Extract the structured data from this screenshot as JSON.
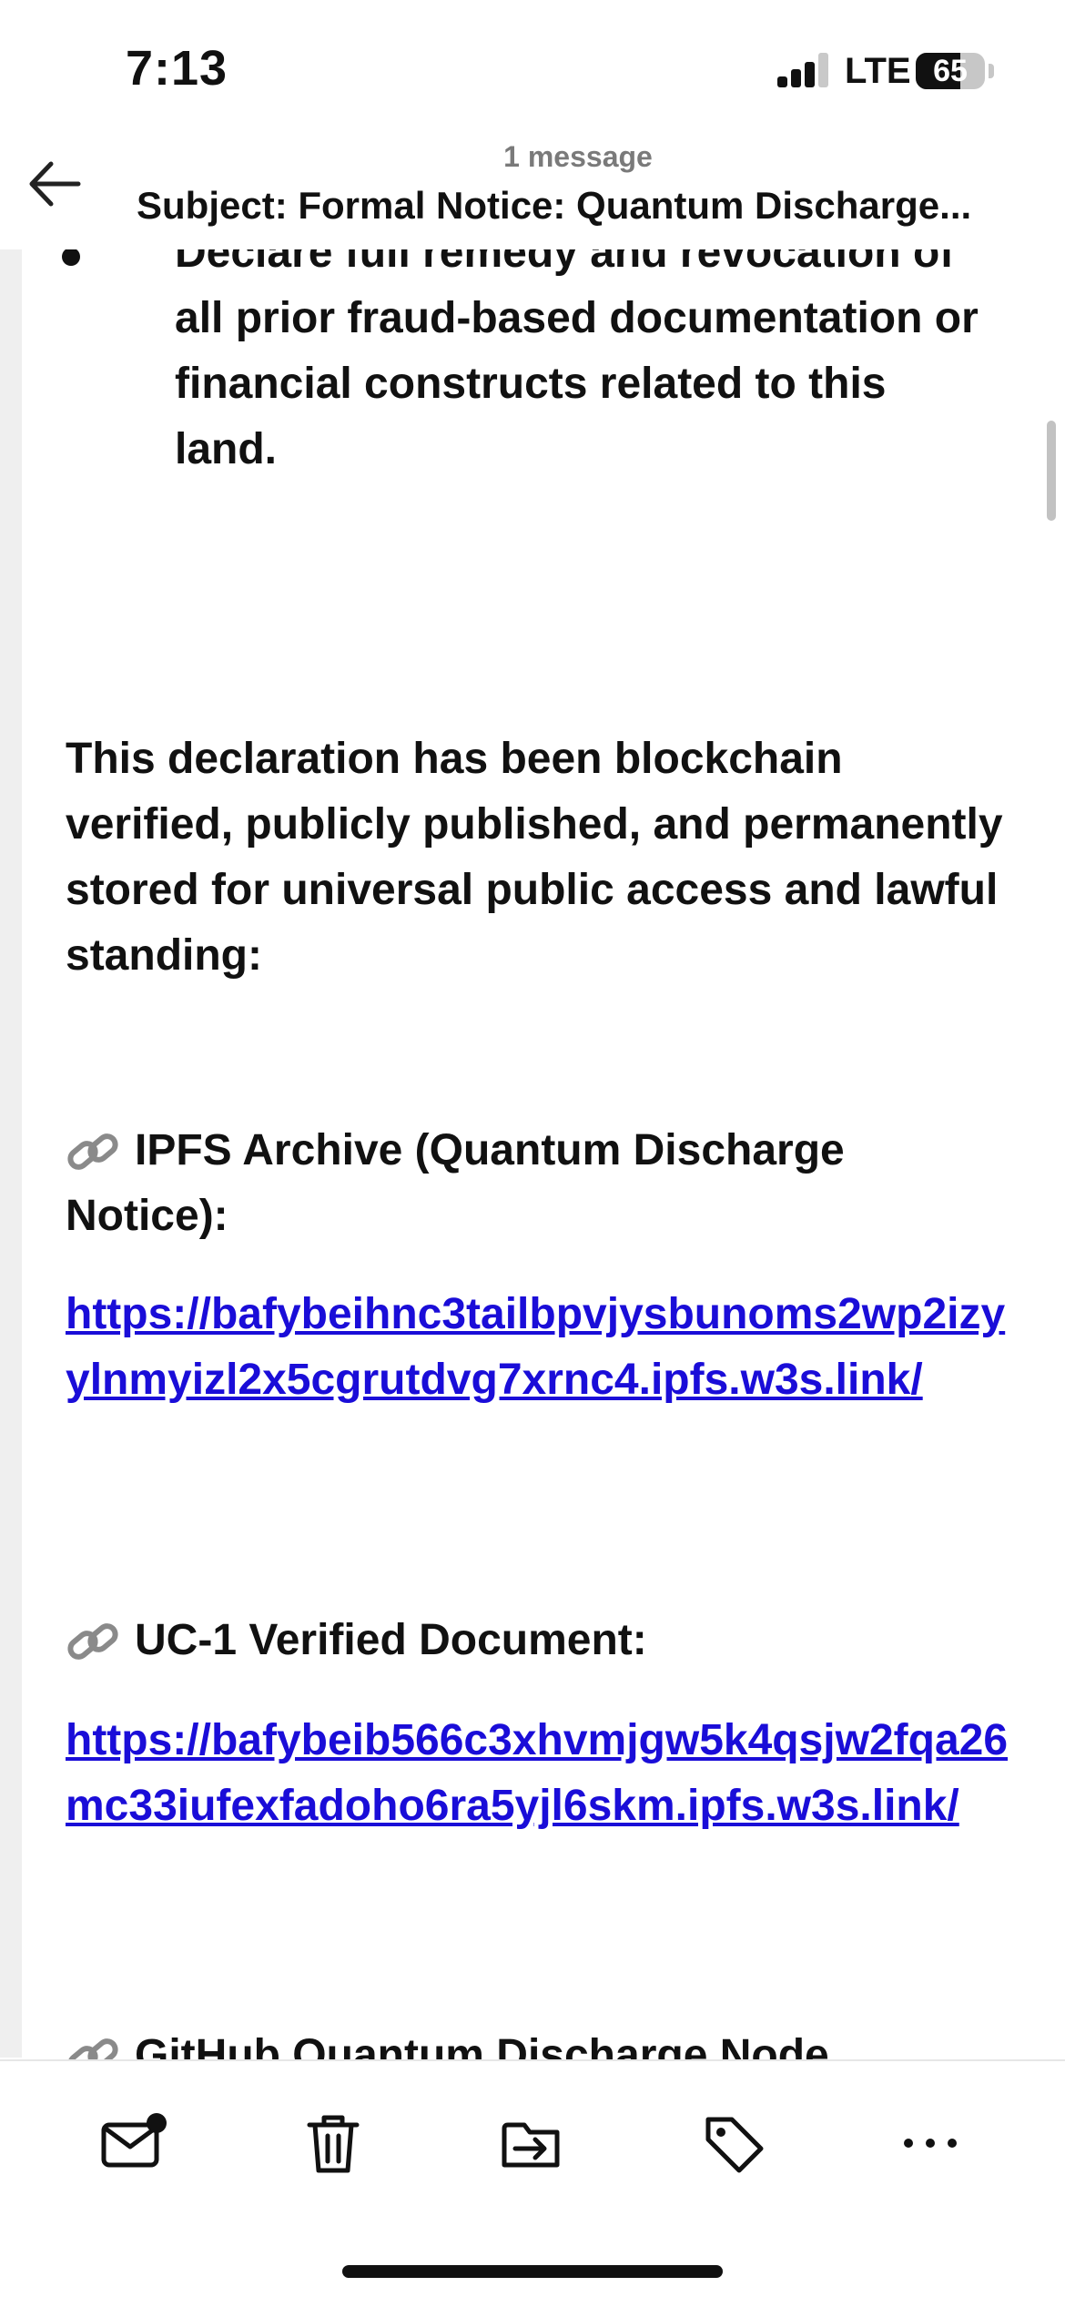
{
  "status_bar": {
    "time": "7:13",
    "network": "LTE",
    "battery_percent": "65",
    "battery_level": 0.65,
    "signal_bars": 3
  },
  "header": {
    "message_count": "1 message",
    "subject": "Subject: Formal Notice: Quantum Discharge..."
  },
  "body": {
    "bullet_text": "Declare full remedy and revocation of all prior fraud-based documentation or financial constructs related to this land.",
    "declaration": "This declaration has been blockchain verified, publicly published, and permanently stored for universal public access and lawful standing:",
    "links": [
      {
        "label": "IPFS Archive (Quantum Discharge Notice):",
        "url": "https://bafybeihnc3tailbpvjysbunoms2wp2izyylnmyizl2x5cgrutdvg7xrnc4.ipfs.w3s.link/"
      },
      {
        "label": "UC-1 Verified Document:",
        "url": "https://bafybeib566c3xhvmjgw5k4qsjw2fqa26mc33iufexfadoho6ra5yjl6skm.ipfs.w3s.link/"
      }
    ],
    "cut_off_text": "GitHub Quantum Discharge Node"
  },
  "toolbar": {
    "icons": [
      "mail-unread-icon",
      "trash-icon",
      "move-to-folder-icon",
      "tag-icon",
      "more-icon"
    ]
  },
  "colors": {
    "link": "#1a0dd8",
    "text": "#141414",
    "gutter": "#efefef"
  }
}
